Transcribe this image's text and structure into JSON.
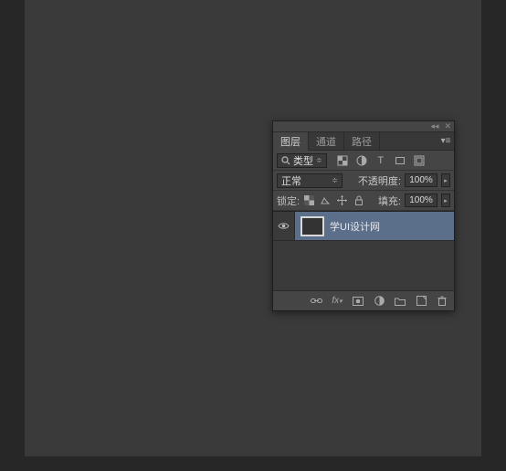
{
  "tabs": {
    "layers": "图层",
    "channels": "通道",
    "paths": "路径"
  },
  "filter": {
    "kind_label": "类型"
  },
  "blend": {
    "mode": "正常",
    "opacity_label": "不透明度:",
    "opacity_value": "100%"
  },
  "lock": {
    "label": "锁定:",
    "fill_label": "填充:",
    "fill_value": "100%"
  },
  "layers": [
    {
      "name": "学UI设计网",
      "visible": true
    }
  ]
}
